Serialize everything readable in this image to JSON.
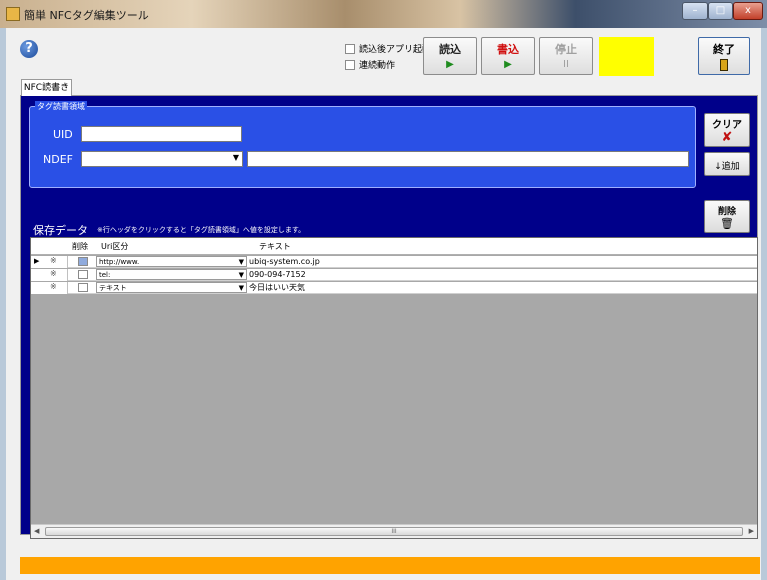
{
  "window": {
    "title": "簡単 NFCタグ編集ツール",
    "controls": {
      "minimize": "–",
      "maximize": "□",
      "close": "x"
    }
  },
  "toolbar": {
    "help_icon": "?",
    "check_after_read": {
      "label": "読込後アプリ起動",
      "checked": false
    },
    "check_continuous": {
      "label": "連続動作",
      "checked": false
    },
    "read_button": {
      "label": "読込",
      "icon": "▶"
    },
    "write_button": {
      "label": "書込",
      "icon": "▶"
    },
    "stop_button": {
      "label": "停止",
      "icon": "II"
    },
    "status_color": "#ffff00",
    "exit_button": {
      "label": "終了"
    }
  },
  "tab": {
    "label": "NFC読書き"
  },
  "tag_area": {
    "title": "タグ読書領域",
    "uid_label": "UID",
    "uid_value": "",
    "ndef_label": "NDEF",
    "ndef_select": "",
    "ndef_text": ""
  },
  "side_buttons": {
    "clear": {
      "label": "クリア",
      "icon": "✘"
    },
    "add": {
      "label": "↓追加"
    },
    "delete": {
      "label": "削除",
      "icon": "🗑"
    }
  },
  "saved": {
    "title": "保存データ",
    "hint": "※行ヘッダをクリックすると「タグ読書領域」へ値を設定します。"
  },
  "grid": {
    "headers": [
      "削除",
      "Uri区分",
      "テキスト"
    ],
    "rows": [
      {
        "uri": "http://www.",
        "text": "ubiq-system.co.jp"
      },
      {
        "uri": "tel:",
        "text": "090-094-7152"
      },
      {
        "uri": "テキスト",
        "text": "今日はいい天気"
      }
    ],
    "scroll_thumb": "III"
  },
  "colors": {
    "panel_bg": "#00008a",
    "group_bg": "#2a50e6",
    "status_bar": "#ffa300"
  }
}
